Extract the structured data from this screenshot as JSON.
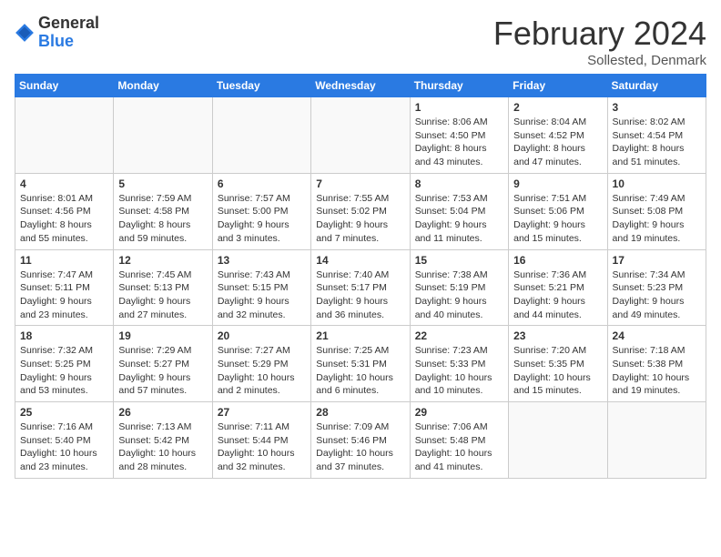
{
  "header": {
    "logo_general": "General",
    "logo_blue": "Blue",
    "month_title": "February 2024",
    "subtitle": "Sollested, Denmark"
  },
  "days_of_week": [
    "Sunday",
    "Monday",
    "Tuesday",
    "Wednesday",
    "Thursday",
    "Friday",
    "Saturday"
  ],
  "weeks": [
    [
      {
        "day": "",
        "info": ""
      },
      {
        "day": "",
        "info": ""
      },
      {
        "day": "",
        "info": ""
      },
      {
        "day": "",
        "info": ""
      },
      {
        "day": "1",
        "info": "Sunrise: 8:06 AM\nSunset: 4:50 PM\nDaylight: 8 hours\nand 43 minutes."
      },
      {
        "day": "2",
        "info": "Sunrise: 8:04 AM\nSunset: 4:52 PM\nDaylight: 8 hours\nand 47 minutes."
      },
      {
        "day": "3",
        "info": "Sunrise: 8:02 AM\nSunset: 4:54 PM\nDaylight: 8 hours\nand 51 minutes."
      }
    ],
    [
      {
        "day": "4",
        "info": "Sunrise: 8:01 AM\nSunset: 4:56 PM\nDaylight: 8 hours\nand 55 minutes."
      },
      {
        "day": "5",
        "info": "Sunrise: 7:59 AM\nSunset: 4:58 PM\nDaylight: 8 hours\nand 59 minutes."
      },
      {
        "day": "6",
        "info": "Sunrise: 7:57 AM\nSunset: 5:00 PM\nDaylight: 9 hours\nand 3 minutes."
      },
      {
        "day": "7",
        "info": "Sunrise: 7:55 AM\nSunset: 5:02 PM\nDaylight: 9 hours\nand 7 minutes."
      },
      {
        "day": "8",
        "info": "Sunrise: 7:53 AM\nSunset: 5:04 PM\nDaylight: 9 hours\nand 11 minutes."
      },
      {
        "day": "9",
        "info": "Sunrise: 7:51 AM\nSunset: 5:06 PM\nDaylight: 9 hours\nand 15 minutes."
      },
      {
        "day": "10",
        "info": "Sunrise: 7:49 AM\nSunset: 5:08 PM\nDaylight: 9 hours\nand 19 minutes."
      }
    ],
    [
      {
        "day": "11",
        "info": "Sunrise: 7:47 AM\nSunset: 5:11 PM\nDaylight: 9 hours\nand 23 minutes."
      },
      {
        "day": "12",
        "info": "Sunrise: 7:45 AM\nSunset: 5:13 PM\nDaylight: 9 hours\nand 27 minutes."
      },
      {
        "day": "13",
        "info": "Sunrise: 7:43 AM\nSunset: 5:15 PM\nDaylight: 9 hours\nand 32 minutes."
      },
      {
        "day": "14",
        "info": "Sunrise: 7:40 AM\nSunset: 5:17 PM\nDaylight: 9 hours\nand 36 minutes."
      },
      {
        "day": "15",
        "info": "Sunrise: 7:38 AM\nSunset: 5:19 PM\nDaylight: 9 hours\nand 40 minutes."
      },
      {
        "day": "16",
        "info": "Sunrise: 7:36 AM\nSunset: 5:21 PM\nDaylight: 9 hours\nand 44 minutes."
      },
      {
        "day": "17",
        "info": "Sunrise: 7:34 AM\nSunset: 5:23 PM\nDaylight: 9 hours\nand 49 minutes."
      }
    ],
    [
      {
        "day": "18",
        "info": "Sunrise: 7:32 AM\nSunset: 5:25 PM\nDaylight: 9 hours\nand 53 minutes."
      },
      {
        "day": "19",
        "info": "Sunrise: 7:29 AM\nSunset: 5:27 PM\nDaylight: 9 hours\nand 57 minutes."
      },
      {
        "day": "20",
        "info": "Sunrise: 7:27 AM\nSunset: 5:29 PM\nDaylight: 10 hours\nand 2 minutes."
      },
      {
        "day": "21",
        "info": "Sunrise: 7:25 AM\nSunset: 5:31 PM\nDaylight: 10 hours\nand 6 minutes."
      },
      {
        "day": "22",
        "info": "Sunrise: 7:23 AM\nSunset: 5:33 PM\nDaylight: 10 hours\nand 10 minutes."
      },
      {
        "day": "23",
        "info": "Sunrise: 7:20 AM\nSunset: 5:35 PM\nDaylight: 10 hours\nand 15 minutes."
      },
      {
        "day": "24",
        "info": "Sunrise: 7:18 AM\nSunset: 5:38 PM\nDaylight: 10 hours\nand 19 minutes."
      }
    ],
    [
      {
        "day": "25",
        "info": "Sunrise: 7:16 AM\nSunset: 5:40 PM\nDaylight: 10 hours\nand 23 minutes."
      },
      {
        "day": "26",
        "info": "Sunrise: 7:13 AM\nSunset: 5:42 PM\nDaylight: 10 hours\nand 28 minutes."
      },
      {
        "day": "27",
        "info": "Sunrise: 7:11 AM\nSunset: 5:44 PM\nDaylight: 10 hours\nand 32 minutes."
      },
      {
        "day": "28",
        "info": "Sunrise: 7:09 AM\nSunset: 5:46 PM\nDaylight: 10 hours\nand 37 minutes."
      },
      {
        "day": "29",
        "info": "Sunrise: 7:06 AM\nSunset: 5:48 PM\nDaylight: 10 hours\nand 41 minutes."
      },
      {
        "day": "",
        "info": ""
      },
      {
        "day": "",
        "info": ""
      }
    ]
  ]
}
